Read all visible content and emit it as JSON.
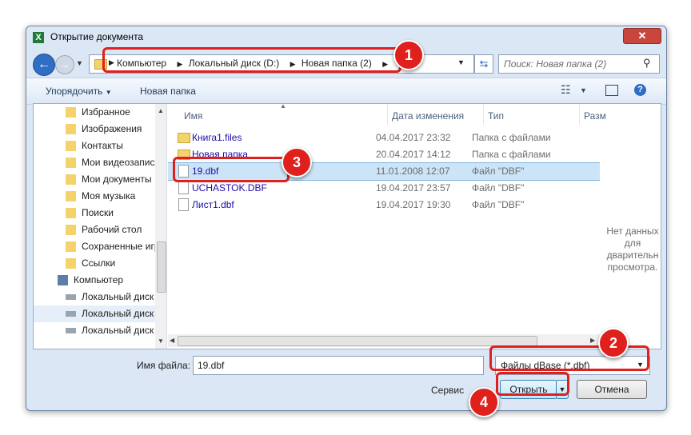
{
  "window": {
    "title": "Открытие документа"
  },
  "address": {
    "crumbs": [
      "Компьютер",
      "Локальный диск (D:)",
      "Новая папка (2)"
    ]
  },
  "search": {
    "placeholder": "Поиск: Новая папка (2)"
  },
  "toolbar": {
    "organize": "Упорядочить",
    "new_folder": "Новая папка"
  },
  "nav": {
    "items": [
      {
        "label": "Избранное",
        "icon": "star-folder-icon"
      },
      {
        "label": "Изображения",
        "icon": "pictures-folder-icon"
      },
      {
        "label": "Контакты",
        "icon": "contacts-folder-icon"
      },
      {
        "label": "Мои видеозаписи",
        "icon": "videos-folder-icon"
      },
      {
        "label": "Мои документы",
        "icon": "documents-folder-icon"
      },
      {
        "label": "Моя музыка",
        "icon": "music-folder-icon"
      },
      {
        "label": "Поиски",
        "icon": "searches-folder-icon"
      },
      {
        "label": "Рабочий стол",
        "icon": "desktop-folder-icon"
      },
      {
        "label": "Сохраненные игры",
        "icon": "games-folder-icon"
      },
      {
        "label": "Ссылки",
        "icon": "links-folder-icon"
      },
      {
        "label": "Компьютер",
        "icon": "computer-icon"
      },
      {
        "label": "Локальный диск",
        "icon": "drive-icon"
      },
      {
        "label": "Локальный диск",
        "icon": "drive-icon",
        "selected": true
      },
      {
        "label": "Локальный диск",
        "icon": "drive-icon"
      }
    ]
  },
  "columns": {
    "name": "Имя",
    "date": "Дата изменения",
    "type": "Тип",
    "size": "Разм"
  },
  "files": [
    {
      "name": "Книга1.files",
      "date": "04.04.2017 23:32",
      "type": "Папка с файлами",
      "kind": "folder"
    },
    {
      "name": "Новая папка",
      "date": "20.04.2017 14:12",
      "type": "Папка с файлами",
      "kind": "folder"
    },
    {
      "name": "19.dbf",
      "date": "11.01.2008 12:07",
      "type": "Файл \"DBF\"",
      "kind": "file",
      "selected": true
    },
    {
      "name": "UCHASTOK.DBF",
      "date": "19.04.2017 23:57",
      "type": "Файл \"DBF\"",
      "kind": "file"
    },
    {
      "name": "Лист1.dbf",
      "date": "19.04.2017 19:30",
      "type": "Файл \"DBF\"",
      "kind": "file"
    }
  ],
  "preview": {
    "text_1": "Нет данных",
    "text_2": "для",
    "text_3": "дварительн",
    "text_4": "просмотра."
  },
  "bottom": {
    "filename_label": "Имя файла:",
    "filename_value": "19.dbf",
    "filetype_value": "Файлы dBase (*.dbf)",
    "service_label": "Сервис",
    "open_label": "Открыть",
    "cancel_label": "Отмена"
  },
  "callouts": {
    "one": "1",
    "two": "2",
    "three": "3",
    "four": "4"
  },
  "colors": {
    "accent": "#e0201c",
    "selection": "#cce4f7",
    "link": "#1a0dab"
  }
}
